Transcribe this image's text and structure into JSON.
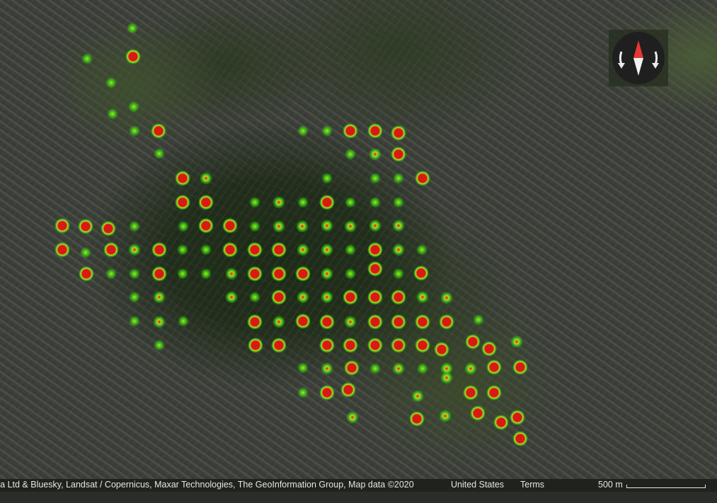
{
  "map": {
    "attribution": "ra Ltd & Bluesky, Landsat / Copernicus, Maxar Technologies, The GeoInformation Group, Map data ©2020",
    "region": "United States",
    "terms_label": "Terms",
    "scale_label": "500 m"
  },
  "compass": {
    "icon": "compass-icon",
    "north_color": "#e53935",
    "south_color": "#f2f2f2"
  },
  "heatmap": {
    "colors": {
      "low": "#39d30f",
      "mid": "#c6e52a",
      "high": "#d81b12"
    },
    "points": [
      [
        187,
        40,
        1
      ],
      [
        188,
        80,
        3
      ],
      [
        123,
        83,
        1
      ],
      [
        157,
        117,
        1
      ],
      [
        189,
        151,
        1
      ],
      [
        159,
        161,
        1
      ],
      [
        224,
        185,
        3
      ],
      [
        190,
        185,
        1
      ],
      [
        225,
        217,
        1
      ],
      [
        258,
        252,
        3
      ],
      [
        291,
        252,
        2
      ],
      [
        258,
        286,
        3
      ],
      [
        291,
        286,
        3
      ],
      [
        259,
        320,
        1
      ],
      [
        291,
        319,
        3
      ],
      [
        325,
        319,
        3
      ],
      [
        360,
        320,
        1
      ],
      [
        394,
        320,
        2
      ],
      [
        427,
        320,
        2
      ],
      [
        462,
        319,
        2
      ],
      [
        495,
        320,
        2
      ],
      [
        530,
        319,
        2
      ],
      [
        563,
        319,
        2
      ],
      [
        88,
        319,
        3
      ],
      [
        121,
        320,
        3
      ],
      [
        153,
        323,
        3
      ],
      [
        190,
        320,
        1
      ],
      [
        88,
        353,
        3
      ],
      [
        121,
        357,
        1
      ],
      [
        157,
        353,
        3
      ],
      [
        190,
        353,
        2
      ],
      [
        225,
        353,
        3
      ],
      [
        258,
        353,
        1
      ],
      [
        291,
        353,
        1
      ],
      [
        325,
        353,
        3
      ],
      [
        360,
        353,
        3
      ],
      [
        394,
        353,
        3
      ],
      [
        428,
        353,
        2
      ],
      [
        462,
        353,
        2
      ],
      [
        495,
        353,
        1
      ],
      [
        530,
        353,
        3
      ],
      [
        563,
        353,
        2
      ],
      [
        596,
        353,
        1
      ],
      [
        122,
        387,
        3
      ],
      [
        157,
        387,
        1
      ],
      [
        190,
        387,
        1
      ],
      [
        225,
        387,
        3
      ],
      [
        258,
        387,
        1
      ],
      [
        291,
        387,
        1
      ],
      [
        327,
        387,
        2
      ],
      [
        360,
        387,
        3
      ],
      [
        394,
        387,
        3
      ],
      [
        428,
        387,
        3
      ],
      [
        462,
        387,
        2
      ],
      [
        495,
        387,
        1
      ],
      [
        530,
        380,
        3
      ],
      [
        563,
        387,
        1
      ],
      [
        595,
        386,
        3
      ],
      [
        190,
        420,
        1
      ],
      [
        225,
        420,
        2
      ],
      [
        327,
        420,
        2
      ],
      [
        360,
        420,
        1
      ],
      [
        394,
        420,
        3
      ],
      [
        428,
        420,
        2
      ],
      [
        462,
        420,
        2
      ],
      [
        495,
        420,
        3
      ],
      [
        530,
        420,
        3
      ],
      [
        563,
        420,
        3
      ],
      [
        597,
        420,
        2
      ],
      [
        631,
        421,
        2
      ],
      [
        190,
        454,
        1
      ],
      [
        225,
        455,
        2
      ],
      [
        259,
        454,
        1
      ],
      [
        360,
        455,
        3
      ],
      [
        394,
        455,
        2
      ],
      [
        428,
        454,
        3
      ],
      [
        462,
        455,
        3
      ],
      [
        495,
        455,
        2
      ],
      [
        530,
        455,
        3
      ],
      [
        563,
        455,
        3
      ],
      [
        597,
        455,
        3
      ],
      [
        631,
        455,
        3
      ],
      [
        676,
        452,
        1
      ],
      [
        225,
        488,
        1
      ],
      [
        361,
        488,
        3
      ],
      [
        394,
        488,
        3
      ],
      [
        462,
        488,
        3
      ],
      [
        495,
        488,
        3
      ],
      [
        530,
        488,
        3
      ],
      [
        563,
        488,
        3
      ],
      [
        597,
        488,
        3
      ],
      [
        624,
        494,
        3
      ],
      [
        668,
        483,
        3
      ],
      [
        691,
        493,
        3
      ],
      [
        730,
        483,
        2
      ],
      [
        428,
        520,
        1
      ],
      [
        462,
        521,
        2
      ],
      [
        497,
        520,
        3
      ],
      [
        530,
        521,
        1
      ],
      [
        563,
        521,
        2
      ],
      [
        597,
        521,
        1
      ],
      [
        631,
        521,
        2
      ],
      [
        665,
        521,
        2
      ],
      [
        698,
        519,
        3
      ],
      [
        735,
        519,
        3
      ],
      [
        462,
        555,
        3
      ],
      [
        492,
        551,
        3
      ],
      [
        631,
        534,
        2
      ],
      [
        665,
        555,
        3
      ],
      [
        698,
        555,
        3
      ],
      [
        428,
        555,
        1
      ],
      [
        590,
        560,
        2
      ],
      [
        498,
        590,
        2
      ],
      [
        589,
        592,
        3
      ],
      [
        629,
        588,
        2
      ],
      [
        675,
        584,
        3
      ],
      [
        708,
        597,
        3
      ],
      [
        731,
        590,
        3
      ],
      [
        735,
        620,
        3
      ],
      [
        428,
        185,
        1
      ],
      [
        462,
        185,
        1
      ],
      [
        495,
        185,
        3
      ],
      [
        530,
        185,
        3
      ],
      [
        563,
        188,
        3
      ],
      [
        495,
        218,
        1
      ],
      [
        530,
        218,
        2
      ],
      [
        563,
        218,
        3
      ],
      [
        462,
        252,
        1
      ],
      [
        530,
        252,
        1
      ],
      [
        563,
        252,
        1
      ],
      [
        597,
        252,
        3
      ],
      [
        462,
        286,
        3
      ],
      [
        495,
        286,
        1
      ],
      [
        530,
        286,
        1
      ],
      [
        563,
        286,
        1
      ],
      [
        394,
        286,
        2
      ],
      [
        360,
        286,
        1
      ],
      [
        428,
        286,
        1
      ]
    ]
  }
}
